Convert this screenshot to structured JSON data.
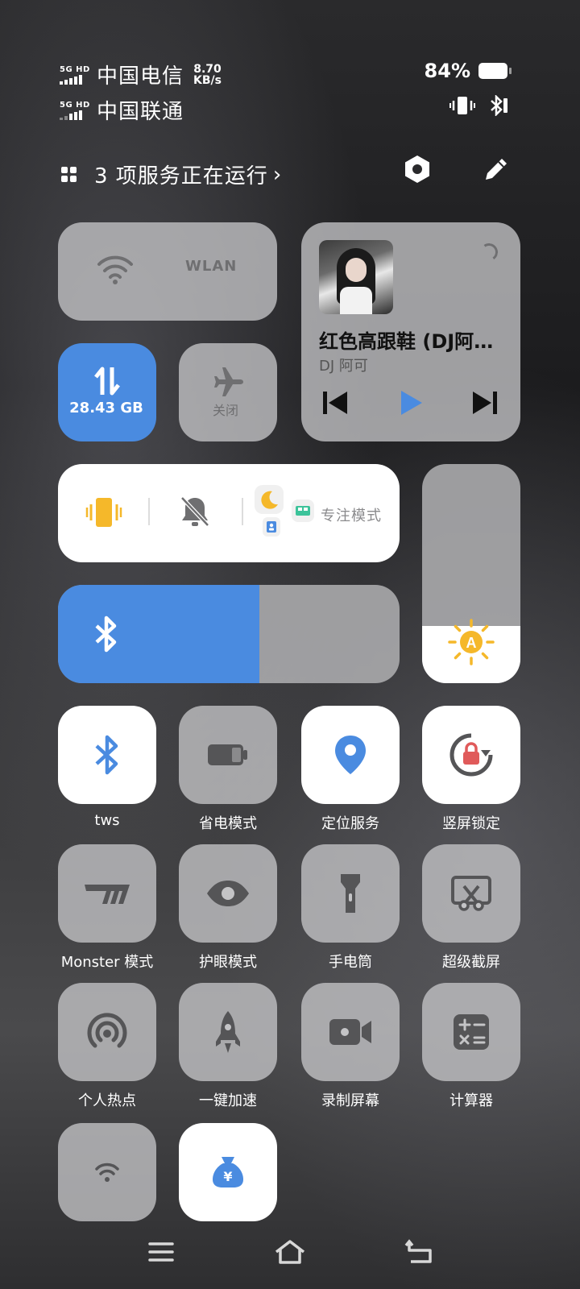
{
  "status_bar": {
    "sim1": {
      "network": "5G HD",
      "carrier": "中国电信"
    },
    "sim2": {
      "network": "5G HD",
      "carrier": "中国联通"
    },
    "speed_value": "8.70",
    "speed_unit": "KB/s",
    "battery_pct": "84%",
    "icons": [
      "vibrate-icon",
      "bluetooth-icon"
    ]
  },
  "header": {
    "services_text": "3 项服务正在运行",
    "chevron": "›",
    "settings_icon": "gear-hex-icon",
    "edit_icon": "pencil-icon"
  },
  "wlan_tile": {
    "label": "WLAN",
    "icon": "wifi-icon",
    "on": false
  },
  "data_tile": {
    "label": "28.43 GB",
    "icon": "data-transfer-icon",
    "on": true
  },
  "airplane_tile": {
    "label": "关闭",
    "icon": "airplane-icon",
    "on": false
  },
  "media": {
    "title": "红色高跟鞋 (DJ阿可版)",
    "artist": "DJ 阿可",
    "colors": {
      "play": "#4a8be0"
    }
  },
  "sound_modes": {
    "vibrate_icon": "vibrate-icon",
    "mute_icon": "bell-off-icon",
    "focus_label": "专注模式",
    "colors": {
      "vibrate": "#f5b82a",
      "moon": "#f5b82a",
      "bed": "#3cc39a",
      "contact": "#4a8be0"
    }
  },
  "bluetooth_slider": {
    "icon": "bluetooth-icon",
    "level": 0.59
  },
  "brightness": {
    "icon": "auto-brightness-icon",
    "level": 0.26,
    "color": "#f5b82a"
  },
  "grid": [
    {
      "label": "tws",
      "icon": "bluetooth-icon",
      "on": true
    },
    {
      "label": "省电模式",
      "icon": "battery-icon",
      "on": false
    },
    {
      "label": "定位服务",
      "icon": "location-pin-icon",
      "on": true
    },
    {
      "label": "竖屏锁定",
      "icon": "rotation-lock-icon",
      "on": true
    },
    {
      "label": "Monster 模式",
      "icon": "monster-icon",
      "on": false
    },
    {
      "label": "护眼模式",
      "icon": "eye-icon",
      "on": false
    },
    {
      "label": "手电筒",
      "icon": "flashlight-icon",
      "on": false
    },
    {
      "label": "超级截屏",
      "icon": "screenshot-icon",
      "on": false
    },
    {
      "label": "个人热点",
      "icon": "hotspot-icon",
      "on": false
    },
    {
      "label": "一键加速",
      "icon": "rocket-icon",
      "on": false
    },
    {
      "label": "录制屏幕",
      "icon": "video-record-icon",
      "on": false
    },
    {
      "label": "计算器",
      "icon": "calculator-icon",
      "on": false
    },
    {
      "label": "",
      "icon": "wifi-small-icon",
      "on": false
    },
    {
      "label": "",
      "icon": "money-bag-icon",
      "on": true
    }
  ],
  "nav": [
    "menu-icon",
    "home-icon",
    "back-icon"
  ]
}
